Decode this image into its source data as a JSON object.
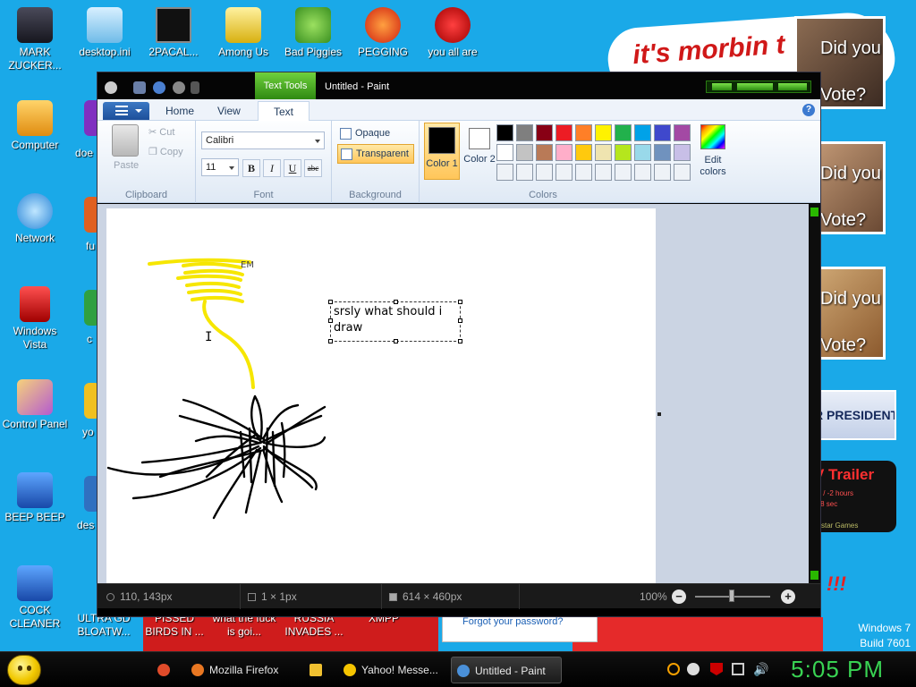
{
  "desktop": {
    "icons_left": [
      {
        "label": "MARK ZUCKER...",
        "color": "#2a2a3a"
      },
      {
        "label": "Computer",
        "color": "#f0b030"
      },
      {
        "label": "Network",
        "color": "#3090e0"
      },
      {
        "label": "Windows Vista",
        "color": "#d02020"
      },
      {
        "label": "Control Panel",
        "color": "#e08c20"
      },
      {
        "label": "BEEP BEEP",
        "color": "#2060c0"
      },
      {
        "label": "COCK CLEANER",
        "color": "#2070d0"
      }
    ],
    "icons_top": [
      {
        "label": "desktop.ini",
        "color": "#7ec8f0"
      },
      {
        "label": "2PACAL...",
        "color": "#111111"
      },
      {
        "label": "Among Us",
        "color": "#e0c020"
      },
      {
        "label": "Bad Piggies",
        "color": "#50b030"
      },
      {
        "label": "PEGGING",
        "color": "#e03020"
      },
      {
        "label": "you all are",
        "color": "#d01818"
      }
    ],
    "icons_col2_partial": [
      {
        "label": "doe",
        "color": "#8030c0"
      },
      {
        "label": "fu",
        "color": "#e06020"
      },
      {
        "label": "c",
        "color": "#30a040"
      },
      {
        "label": "yo",
        "color": "#f0c020"
      },
      {
        "label": "des",
        "color": "#3070c0"
      }
    ],
    "icons_bottom": [
      "ULTRA GD BLOATW...",
      "PISSED BIRDS IN ...",
      "what the fuck is goi...",
      "RUSSIA INVADES ...",
      "XMPP"
    ],
    "wallpaper_banner": "it's morbin t",
    "posters": [
      {
        "line1": "Did you",
        "line2": "Vote?"
      },
      {
        "line1": "Did you",
        "line2": "Vote?"
      },
      {
        "line1": "Did you",
        "line2": "Vote?"
      }
    ],
    "president_badge": "R PRESIDENT",
    "trailer": {
      "title": "V Trailer",
      "line1": "vs / -2 hours",
      "line2": "-48 sec",
      "line3": "ckstar Games"
    },
    "exclaim": "!!!",
    "forgot_password": "Forgot your password?",
    "os_name": "Windows 7",
    "build": "Build 7601"
  },
  "paint": {
    "context_tab": "Text Tools",
    "title": "Untitled - Paint",
    "tabs": {
      "home": "Home",
      "view": "View",
      "text": "Text"
    },
    "help": "?",
    "clipboard": {
      "paste": "Paste",
      "cut": "Cut",
      "copy": "Copy",
      "label": "Clipboard"
    },
    "font": {
      "family": "Calibri",
      "size": "11",
      "bold": "B",
      "italic": "I",
      "underline": "U",
      "strike": "abc",
      "label": "Font"
    },
    "background": {
      "opaque": "Opaque",
      "transparent": "Transparent",
      "label": "Background"
    },
    "colors": {
      "color1": "Color 1",
      "color2": "Color 2",
      "color1_value": "#000000",
      "color2_value": "#ffffff",
      "edit": "Edit colors",
      "label": "Colors",
      "palette": [
        "#000000",
        "#7f7f7f",
        "#880015",
        "#ed1c24",
        "#ff7f27",
        "#fff200",
        "#22b14c",
        "#00a2e8",
        "#3f48cc",
        "#a349a4",
        "#ffffff",
        "#c3c3c3",
        "#b97a57",
        "#ffaec9",
        "#ffc90e",
        "#efe4b0",
        "#b5e61d",
        "#99d9ea",
        "#7092be",
        "#c8bfe7",
        "#eef2f7",
        "#eef2f7",
        "#eef2f7",
        "#eef2f7",
        "#eef2f7",
        "#eef2f7",
        "#eef2f7",
        "#eef2f7",
        "#eef2f7",
        "#eef2f7"
      ]
    },
    "canvas_text": "srsly what should i draw",
    "status": {
      "position": "110, 143px",
      "selection": "1 × 1px",
      "size": "614 × 460px",
      "zoom": "100%"
    }
  },
  "taskbar": {
    "items": [
      {
        "label": "",
        "color": "#e04b2a"
      },
      {
        "label": "Mozilla Firefox",
        "color": "#e87722"
      },
      {
        "label": "",
        "color": "#f0c030"
      },
      {
        "label": "Yahoo! Messe...",
        "color": "#f5c400"
      },
      {
        "label": "Untitled - Paint",
        "color": "#4a90d9"
      }
    ],
    "clock": "5:05 PM"
  }
}
